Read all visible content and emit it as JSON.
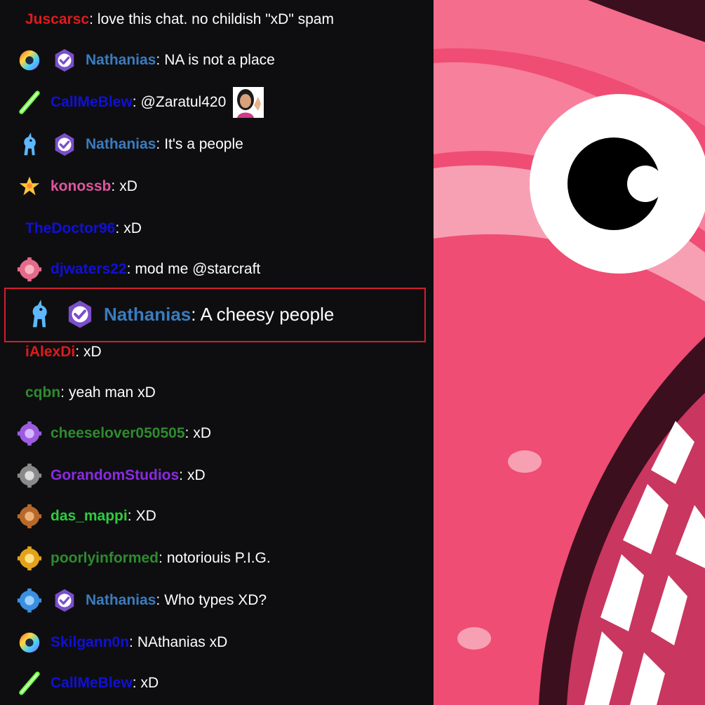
{
  "chat": {
    "messages": [
      {
        "user": "Juscarsc",
        "user_color": "#e01a1a",
        "text": "love this chat. no childish \"xD\" spam",
        "badges": []
      },
      {
        "user": "Nathanias",
        "user_color": "#3a7cbf",
        "text": "NA is not a place",
        "badges": [
          "rainbow-gear-badge",
          "verified-badge"
        ]
      },
      {
        "user": "CallMeBlew",
        "user_color": "#1010d8",
        "text": "@Zaratul420",
        "badges": [
          "green-lightsaber-badge"
        ],
        "emote": "waving-woman-emote"
      },
      {
        "user": "Nathanias",
        "user_color": "#3a7cbf",
        "text": "It's a people",
        "badges": [
          "blue-unicorn-badge",
          "verified-badge"
        ]
      },
      {
        "user": "konossb",
        "user_color": "#e0569d",
        "text": "xD",
        "badges": [
          "gold-crown-badge"
        ]
      },
      {
        "user": "TheDoctor96",
        "user_color": "#1010d8",
        "text": "xD",
        "badges": []
      },
      {
        "user": "djwaters22",
        "user_color": "#1010d8",
        "text": "mod me @starcraft",
        "badges": [
          "pink-gear-badge"
        ]
      },
      {
        "user": "Nathanias",
        "user_color": "#3a7cbf",
        "text": "A cheesy people",
        "badges": [
          "blue-unicorn-badge",
          "verified-badge"
        ],
        "highlighted": true
      },
      {
        "user": "iAlexDi",
        "user_color": "#e01a1a",
        "text": "xD",
        "badges": []
      },
      {
        "user": "cqbn",
        "user_color": "#2e8b2e",
        "text": "yeah man xD",
        "badges": []
      },
      {
        "user": "cheeselover050505",
        "user_color": "#2e8b2e",
        "text": "xD",
        "badges": [
          "purple-gear-badge"
        ]
      },
      {
        "user": "GorandomStudios",
        "user_color": "#8a2be2",
        "text": "xD",
        "badges": [
          "gray-gear-badge"
        ]
      },
      {
        "user": "das_mappi",
        "user_color": "#2ecc40",
        "text": "XD",
        "badges": [
          "bronze-gear-badge"
        ]
      },
      {
        "user": "poorlyinformed",
        "user_color": "#2e8b2e",
        "text": "notoriouis P.I.G.",
        "badges": [
          "gold-gear-badge"
        ]
      },
      {
        "user": "Nathanias",
        "user_color": "#3a7cbf",
        "text": "Who types XD?",
        "badges": [
          "blue-gear-badge",
          "verified-badge"
        ]
      },
      {
        "user": "Skilgann0n",
        "user_color": "#1010d8",
        "text": "NAthanias xD",
        "badges": [
          "rainbow-gear-badge"
        ]
      },
      {
        "user": "CallMeBlew",
        "user_color": "#1010d8",
        "text": "xD",
        "badges": [
          "green-lightsaber-badge"
        ]
      }
    ]
  },
  "colors": {
    "chat_bg": "#0e0e10",
    "highlight_border": "#d21f2c",
    "verified_purple": "#7a4fc9",
    "art_pink": "#f0577a",
    "art_dark": "#3b0f1e"
  },
  "art": {
    "name": "pink-monster-artwork"
  }
}
